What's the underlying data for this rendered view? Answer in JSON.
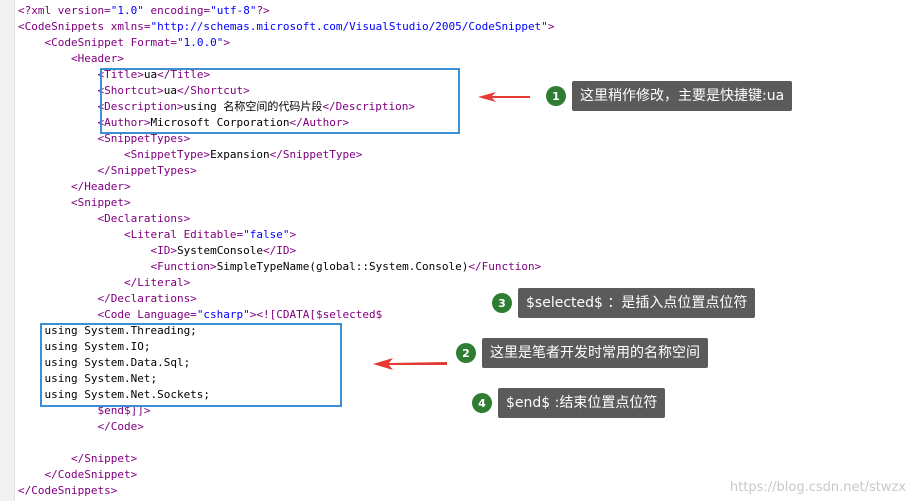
{
  "lines": [
    [
      {
        "t": "<?xml version=",
        "c": "tag"
      },
      {
        "t": "\"1.0\"",
        "c": "val"
      },
      {
        "t": " encoding=",
        "c": "tag"
      },
      {
        "t": "\"utf-8\"",
        "c": "val"
      },
      {
        "t": "?>",
        "c": "tag"
      }
    ],
    [
      {
        "t": "<CodeSnippets xmlns=",
        "c": "tag"
      },
      {
        "t": "\"http://schemas.microsoft.com/VisualStudio/2005/CodeSnippet\"",
        "c": "val"
      },
      {
        "t": ">",
        "c": "tag"
      }
    ],
    [
      {
        "t": "    <CodeSnippet Format=",
        "c": "tag"
      },
      {
        "t": "\"1.0.0\"",
        "c": "val"
      },
      {
        "t": ">",
        "c": "tag"
      }
    ],
    [
      {
        "t": "        <Header>",
        "c": "tag"
      }
    ],
    [
      {
        "t": "            <Title>",
        "c": "tag"
      },
      {
        "t": "ua",
        "c": "text"
      },
      {
        "t": "</Title>",
        "c": "tag"
      }
    ],
    [
      {
        "t": "            <Shortcut>",
        "c": "tag"
      },
      {
        "t": "ua",
        "c": "text"
      },
      {
        "t": "</Shortcut>",
        "c": "tag"
      }
    ],
    [
      {
        "t": "            <Description>",
        "c": "tag"
      },
      {
        "t": "using ",
        "c": "text"
      },
      {
        "t": "名称空间的代码片段",
        "c": "text cjk"
      },
      {
        "t": "</Description>",
        "c": "tag"
      }
    ],
    [
      {
        "t": "            <Author>",
        "c": "tag"
      },
      {
        "t": "Microsoft Corporation",
        "c": "text"
      },
      {
        "t": "</Author>",
        "c": "tag"
      }
    ],
    [
      {
        "t": "            <SnippetTypes>",
        "c": "tag"
      }
    ],
    [
      {
        "t": "                <SnippetType>",
        "c": "tag"
      },
      {
        "t": "Expansion",
        "c": "text"
      },
      {
        "t": "</SnippetType>",
        "c": "tag"
      }
    ],
    [
      {
        "t": "            </SnippetTypes>",
        "c": "tag"
      }
    ],
    [
      {
        "t": "        </Header>",
        "c": "tag"
      }
    ],
    [
      {
        "t": "        <Snippet>",
        "c": "tag"
      }
    ],
    [
      {
        "t": "            <Declarations>",
        "c": "tag"
      }
    ],
    [
      {
        "t": "                <Literal Editable=",
        "c": "tag"
      },
      {
        "t": "\"false\"",
        "c": "val"
      },
      {
        "t": ">",
        "c": "tag"
      }
    ],
    [
      {
        "t": "                    <ID>",
        "c": "tag"
      },
      {
        "t": "SystemConsole",
        "c": "text"
      },
      {
        "t": "</ID>",
        "c": "tag"
      }
    ],
    [
      {
        "t": "                    <Function>",
        "c": "tag"
      },
      {
        "t": "SimpleTypeName(global::System.Console)",
        "c": "text"
      },
      {
        "t": "</Function>",
        "c": "tag"
      }
    ],
    [
      {
        "t": "                </Literal>",
        "c": "tag"
      }
    ],
    [
      {
        "t": "            </Declarations>",
        "c": "tag"
      }
    ],
    [
      {
        "t": "            <Code Language=",
        "c": "tag"
      },
      {
        "t": "\"csharp\"",
        "c": "val"
      },
      {
        "t": "><![CDATA[$selected$",
        "c": "tag"
      }
    ],
    [
      {
        "t": "    using System.Threading;",
        "c": "text"
      }
    ],
    [
      {
        "t": "    using System.IO;",
        "c": "text"
      }
    ],
    [
      {
        "t": "    using System.Data.Sql;",
        "c": "text"
      }
    ],
    [
      {
        "t": "    using System.Net;",
        "c": "text"
      }
    ],
    [
      {
        "t": "    using System.Net.Sockets;",
        "c": "text"
      }
    ],
    [
      {
        "t": "            $end$]]>",
        "c": "tag"
      }
    ],
    [
      {
        "t": "            </Code>",
        "c": "tag"
      }
    ],
    [
      {
        "t": "",
        "c": "text"
      }
    ],
    [
      {
        "t": "        </Snippet>",
        "c": "tag"
      }
    ],
    [
      {
        "t": "    </CodeSnippet>",
        "c": "tag"
      }
    ],
    [
      {
        "t": "</CodeSnippets>",
        "c": "tag"
      }
    ]
  ],
  "callouts": {
    "c1": {
      "num": "1",
      "text": "这里稍作修改，主要是快捷键:ua"
    },
    "c2": {
      "num": "2",
      "text": "这里是笔者开发时常用的名称空间"
    },
    "c3": {
      "num": "3",
      "text": "$selected$ ：是插入点位置点位符"
    },
    "c4": {
      "num": "4",
      "text": "$end$ :结束位置点位符"
    }
  },
  "colors": {
    "tag": "#800080",
    "attr": "#ff0000",
    "value": "#0000ff",
    "highlight_box": "#3b8fd2",
    "arrow": "#e53935",
    "badge": "#2e7d32",
    "bubble": "#5b5b5b"
  },
  "watermark": "https://blog.csdn.net/stwzx"
}
